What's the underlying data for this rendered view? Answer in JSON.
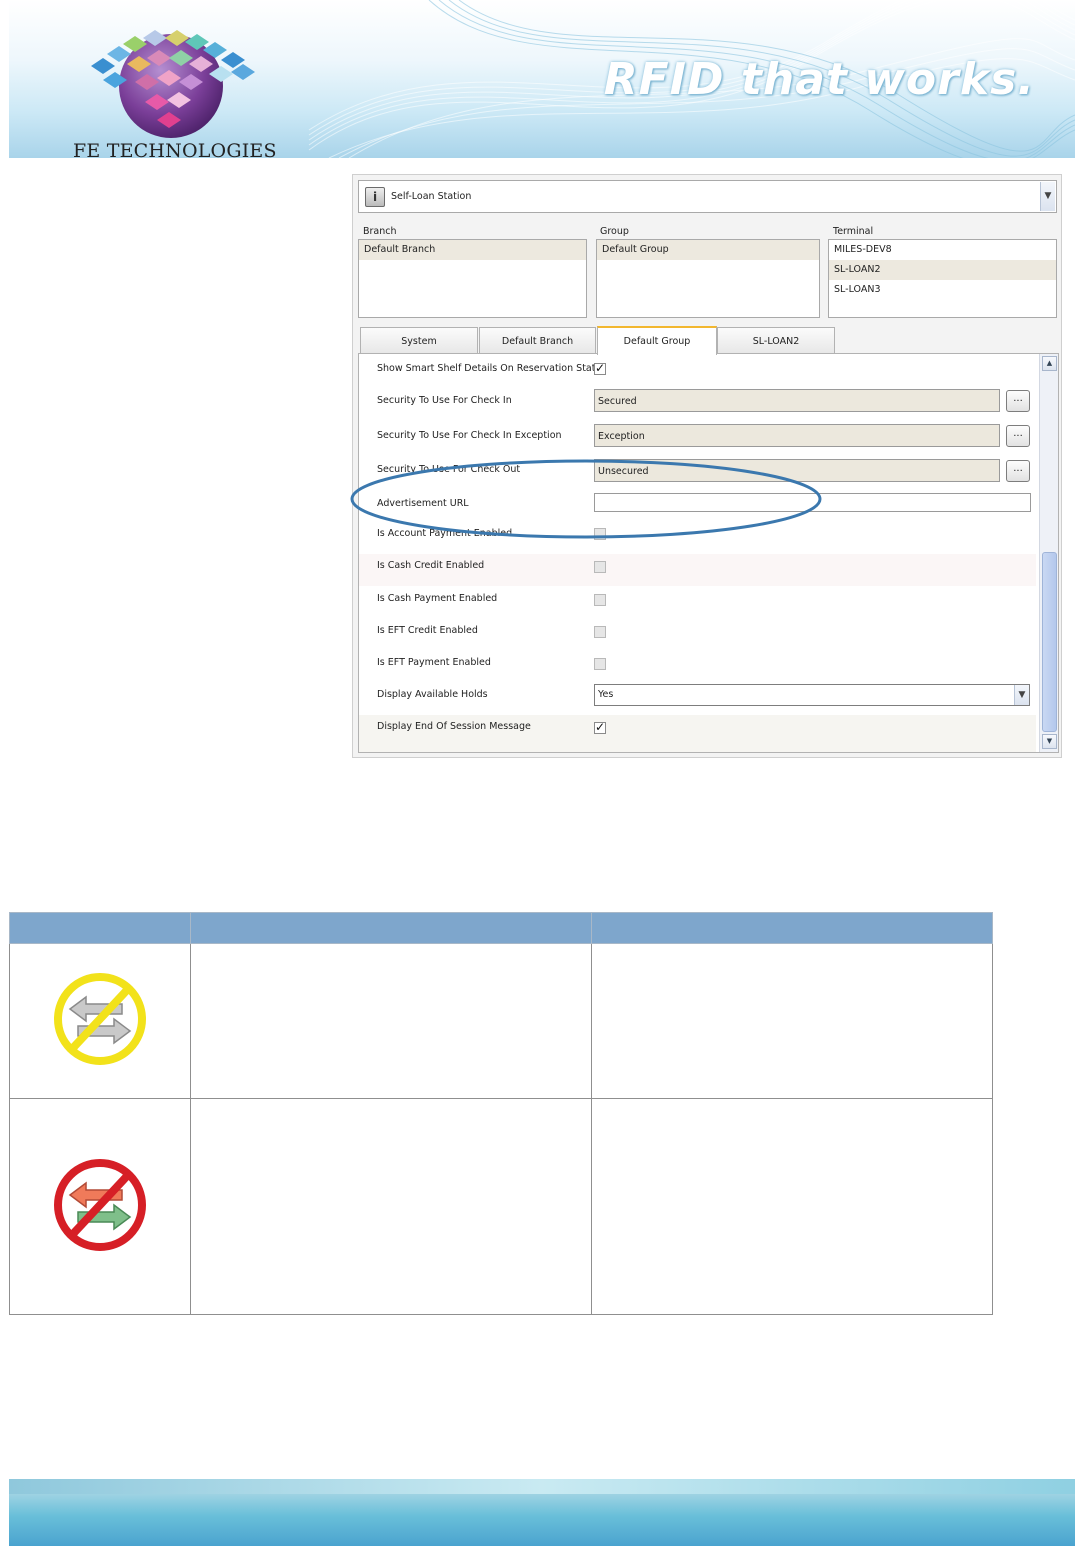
{
  "header": {
    "tagline": "RFID that works.",
    "company_name": "FE TECHNOLOGIES"
  },
  "app": {
    "station_selector": "Self-Loan Station",
    "columns": {
      "branch": {
        "label": "Branch",
        "items": [
          "Default Branch"
        ],
        "selected": "Default Branch"
      },
      "group": {
        "label": "Group",
        "items": [
          "Default Group"
        ],
        "selected": "Default Group"
      },
      "terminal": {
        "label": "Terminal",
        "items": [
          "MILES-DEV8",
          "SL-LOAN2",
          "SL-LOAN3"
        ],
        "selected": "SL-LOAN2"
      }
    },
    "tabs": [
      "System",
      "Default Branch",
      "Default Group",
      "SL-LOAN2"
    ],
    "active_tab": "Default Group",
    "properties": [
      {
        "label": "Show Smart Shelf Details On Reservation Status",
        "type": "checkbox",
        "checked": true
      },
      {
        "label": "Security To Use For Check In",
        "type": "picker",
        "value": "Secured",
        "button": "..."
      },
      {
        "label": "Security To Use For Check In Exception",
        "type": "picker",
        "value": "Exception",
        "button": "..."
      },
      {
        "label": "Security To Use For Check Out",
        "type": "picker",
        "value": "Unsecured",
        "button": "..."
      },
      {
        "label": "Advertisement URL",
        "type": "text",
        "value": ""
      },
      {
        "label": "Is Account Payment Enabled",
        "type": "checkbox",
        "checked": false
      },
      {
        "label": "Is Cash Credit Enabled",
        "type": "checkbox",
        "checked": false
      },
      {
        "label": "Is Cash Payment Enabled",
        "type": "checkbox",
        "checked": false
      },
      {
        "label": "Is EFT Credit Enabled",
        "type": "checkbox",
        "checked": false
      },
      {
        "label": "Is EFT Payment Enabled",
        "type": "checkbox",
        "checked": false
      },
      {
        "label": "Display Available Holds",
        "type": "select",
        "value": "Yes"
      },
      {
        "label": "Display End Of Session Message",
        "type": "checkbox",
        "checked": true
      }
    ]
  },
  "status_table": {
    "headers": [
      "",
      "",
      ""
    ],
    "rows": [
      {
        "icon": "no-connection-yellow-icon",
        "col2": "",
        "col3": ""
      },
      {
        "icon": "no-connection-red-icon",
        "col2": "",
        "col3": ""
      }
    ]
  },
  "colors": {
    "table_header": "#7ea6cc",
    "tab_highlight": "#f2b72f",
    "highlight_ellipse": "#3b78ae",
    "warning_yellow": "#f2e21a",
    "error_red": "#d61f26"
  }
}
